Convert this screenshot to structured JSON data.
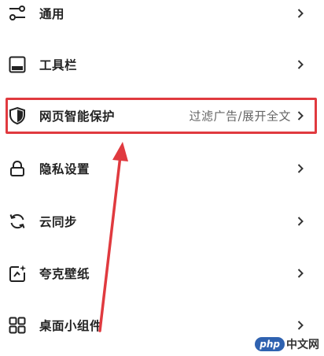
{
  "settings": {
    "items": [
      {
        "label": "通用",
        "icon": "sliders-icon"
      },
      {
        "label": "工具栏",
        "icon": "toolbar-icon"
      },
      {
        "label": "网页智能保护",
        "icon": "shield-icon",
        "value": "过滤广告/展开全文"
      },
      {
        "label": "隐私设置",
        "icon": "lock-icon"
      },
      {
        "label": "云同步",
        "icon": "sync-icon"
      },
      {
        "label": "夸克壁纸",
        "icon": "wallpaper-icon"
      },
      {
        "label": "桌面小组件",
        "icon": "widgets-icon"
      }
    ]
  },
  "annotation": {
    "color": "#e03a3f"
  },
  "watermark": {
    "php": "php",
    "site": "中文网"
  }
}
